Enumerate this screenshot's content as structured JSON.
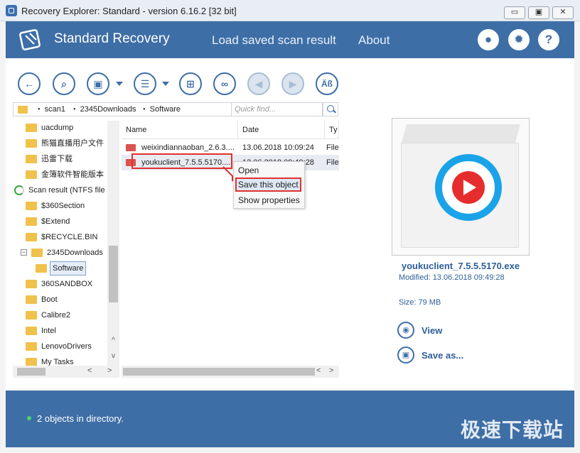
{
  "window": {
    "title": "Recovery Explorer: Standard - version 6.16.2 [32 bit]",
    "min_glyph": "▭",
    "max_glyph": "▣",
    "close_glyph": "✕"
  },
  "header": {
    "brand": "Standard Recovery",
    "nav": [
      "Load saved scan result",
      "About"
    ],
    "icons": [
      "user-icon",
      "gear-icon",
      "help-icon"
    ],
    "help_glyph": "?",
    "user_glyph": "●",
    "gear_glyph": "✹",
    "color": "#3e6ea6"
  },
  "toolbar": {
    "buttons": [
      {
        "name": "back-icon",
        "glyph": "←"
      },
      {
        "name": "search-icon",
        "glyph": "⌕"
      },
      {
        "name": "save-icon",
        "glyph": "▣"
      },
      {
        "name": "list-icon",
        "glyph": "☰"
      },
      {
        "name": "thumbnails-icon",
        "glyph": "⊞"
      },
      {
        "name": "binoculars-icon",
        "glyph": "∞"
      },
      {
        "name": "previous-icon",
        "glyph": "◀"
      },
      {
        "name": "next-icon",
        "glyph": "▶"
      },
      {
        "name": "encoding-icon",
        "glyph": "Äß"
      }
    ]
  },
  "breadcrumb": [
    "scan1",
    "2345Downloads",
    "Software"
  ],
  "quick_find": {
    "placeholder": "Quick find..."
  },
  "tree": {
    "items": [
      {
        "label": "uacdump"
      },
      {
        "label": "熊猫直播用户文件"
      },
      {
        "label": "迅雷下载"
      },
      {
        "label": "金簿软件智能版本"
      },
      {
        "label": "Scan result (NTFS file system)"
      },
      {
        "label": "$360Section"
      },
      {
        "label": "$Extend"
      },
      {
        "label": "$RECYCLE.BIN"
      },
      {
        "label": "2345Downloads"
      },
      {
        "label": "Software"
      },
      {
        "label": "360SANDBOX"
      },
      {
        "label": "Boot"
      },
      {
        "label": "Calibre2"
      },
      {
        "label": "Intel"
      },
      {
        "label": "LenovoDrivers"
      },
      {
        "label": "My Tasks"
      }
    ],
    "expander_glyph": "−",
    "scroll_up": "^",
    "scroll_down": "v",
    "scroll_left": "<",
    "scroll_right": ">"
  },
  "files": {
    "columns": [
      "Name",
      "Date",
      "Ty"
    ],
    "rows": [
      {
        "name": "weixindiannaoban_2.6.3....",
        "date": "13.06.2018 10:09:24",
        "type": "File"
      },
      {
        "name": "youkuclient_7.5.5.5170....",
        "date": "13.06.2018 09:49:28",
        "type": "File"
      }
    ]
  },
  "context_menu": {
    "items": [
      "Open",
      "Save this object",
      "Show properties"
    ]
  },
  "preview": {
    "filename": "youkuclient_7.5.5.5170.exe",
    "modified": "Modified: 13.06.2018 09:49:28",
    "size": "Size: 79 MB",
    "actions": [
      {
        "label": "View",
        "icon": "eye-icon",
        "glyph": "◉"
      },
      {
        "label": "Save as...",
        "icon": "save-icon",
        "glyph": "▣"
      }
    ]
  },
  "status": {
    "message": "2 objects in directory.",
    "watermark": "极速下载站"
  }
}
